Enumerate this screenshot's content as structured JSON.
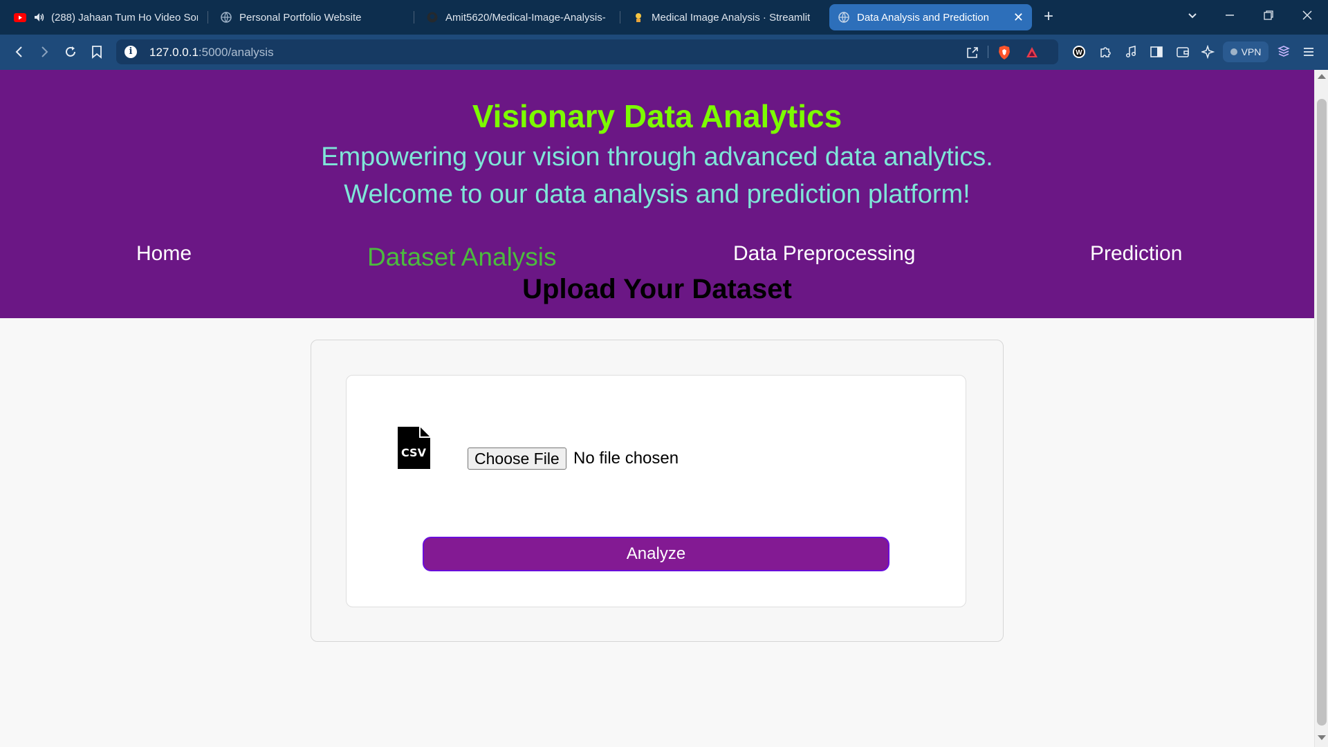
{
  "browser": {
    "tabs": [
      {
        "title": "(288) Jahaan Tum Ho Video Son",
        "icon": "youtube-icon"
      },
      {
        "title": "Personal Portfolio Website",
        "icon": "globe-icon"
      },
      {
        "title": "Amit5620/Medical-Image-Analysis-",
        "icon": "github-icon"
      },
      {
        "title": "Medical Image Analysis · Streamlit",
        "icon": "streamlit-icon"
      },
      {
        "title": "Data Analysis and Prediction",
        "icon": "globe-icon",
        "active": true
      }
    ],
    "url_host": "127.0.0.1",
    "url_path": ":5000/analysis",
    "vpn_label": "VPN",
    "accent": "#2d6fba"
  },
  "header": {
    "brand": "Visionary Data Analytics",
    "tagline_1": "Empowering your vision through advanced data analytics.",
    "tagline_2": "Welcome to our data analysis and prediction platform!",
    "bg_color": "#6b1785",
    "brand_color": "#7cfc00"
  },
  "nav": {
    "home": "Home",
    "dataset_analysis": "Dataset Analysis",
    "data_preprocessing": "Data Preprocessing",
    "prediction": "Prediction",
    "active": "Dataset Analysis"
  },
  "upload": {
    "title": "Upload Your Dataset",
    "choose_file": "Choose File",
    "no_file": "No file chosen",
    "analyze": "Analyze",
    "icon": "csv-file-icon",
    "button_color": "#831a93"
  }
}
